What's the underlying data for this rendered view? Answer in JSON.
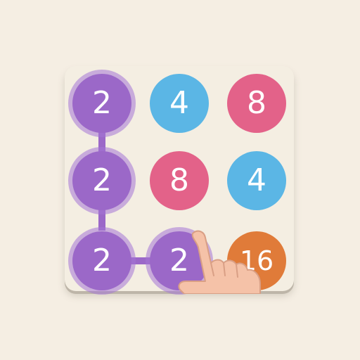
{
  "game": {
    "selected_path": [
      "0-0",
      "1-0",
      "2-0",
      "2-1"
    ],
    "tiles": [
      {
        "id": "0-0",
        "row": 0,
        "col": 0,
        "value": "2",
        "color": "#9b68c8",
        "selected": true
      },
      {
        "id": "0-1",
        "row": 0,
        "col": 1,
        "value": "4",
        "color": "#5bb6e5",
        "selected": false
      },
      {
        "id": "0-2",
        "row": 0,
        "col": 2,
        "value": "8",
        "color": "#e36289",
        "selected": false
      },
      {
        "id": "1-0",
        "row": 1,
        "col": 0,
        "value": "2",
        "color": "#9b68c8",
        "selected": true
      },
      {
        "id": "1-1",
        "row": 1,
        "col": 1,
        "value": "8",
        "color": "#e36289",
        "selected": false
      },
      {
        "id": "1-2",
        "row": 1,
        "col": 2,
        "value": "4",
        "color": "#5bb6e5",
        "selected": false
      },
      {
        "id": "2-0",
        "row": 2,
        "col": 0,
        "value": "2",
        "color": "#9b68c8",
        "selected": true
      },
      {
        "id": "2-1",
        "row": 2,
        "col": 1,
        "value": "2",
        "color": "#9b68c8",
        "selected": true
      },
      {
        "id": "2-2",
        "row": 2,
        "col": 2,
        "value": "16",
        "color": "#e07b39",
        "selected": false
      }
    ],
    "colors": {
      "background": "#f5eee3",
      "board": "#f4eee2",
      "connector": "#9b68c8",
      "hand": "#f5c2a8"
    },
    "icons": [
      "pointing-hand-icon"
    ]
  }
}
